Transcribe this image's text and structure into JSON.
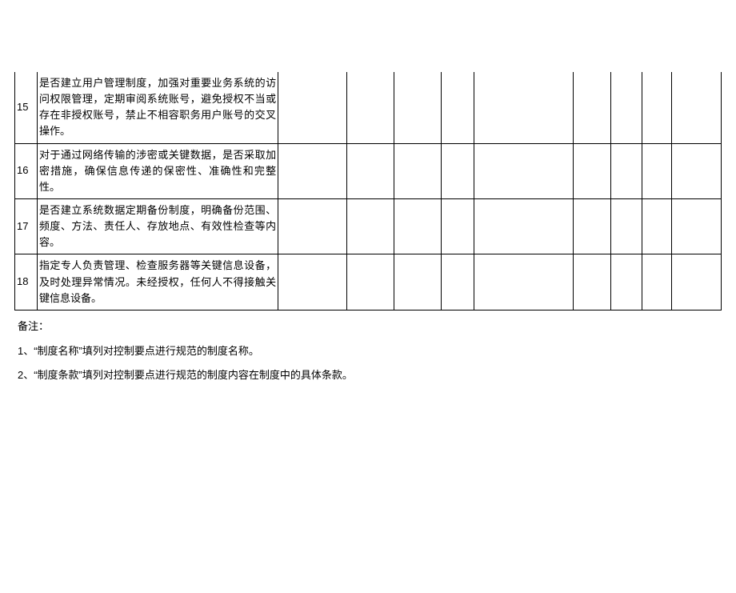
{
  "table": {
    "rows": [
      {
        "num": "15",
        "desc": "是否建立用户管理制度，加强对重要业务系统的访问权限管理，定期审阅系统账号，避免授权不当或存在非授权账号，禁止不相容职务用户账号的交叉操作。"
      },
      {
        "num": "16",
        "desc": "对于通过网络传输的涉密或关键数据，是否采取加密措施，确保信息传递的保密性、准确性和完整性。"
      },
      {
        "num": "17",
        "desc": "是否建立系统数据定期备份制度，明确备份范围、频度、方法、责任人、存放地点、有效性检查等内容。"
      },
      {
        "num": "18",
        "desc": "指定专人负责管理、检查服务器等关键信息设备，及时处理异常情况。未经授权，任何人不得接触关键信息设备。"
      }
    ]
  },
  "notes": {
    "heading": "备注：",
    "line1": "1、“制度名称”填列对控制要点进行规范的制度名称。",
    "line2": "2、“制度条款”填列对控制要点进行规范的制度内容在制度中的具体条款。"
  }
}
